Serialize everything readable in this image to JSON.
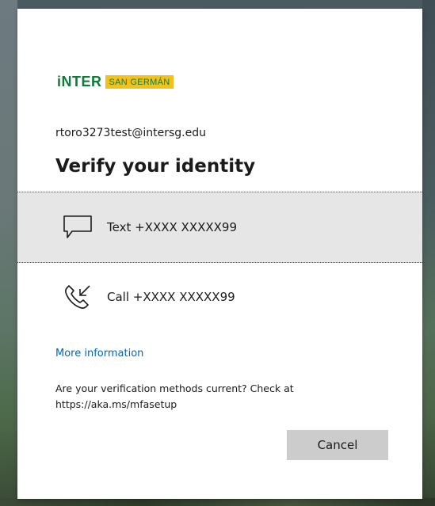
{
  "brand": {
    "name": "iNTER",
    "campus": "SAN GERMÁN"
  },
  "account": {
    "email": "rtoro3273test@intersg.edu"
  },
  "dialog": {
    "title": "Verify your identity",
    "methods": [
      {
        "icon": "sms-icon",
        "label": "Text +XXXX XXXXX99",
        "selected": true
      },
      {
        "icon": "phone-call-icon",
        "label": "Call +XXXX XXXXX99",
        "selected": false
      }
    ],
    "more_info_link": "More information",
    "notice_line1": "Are your verification methods current? Check at",
    "notice_line2": "https://aka.ms/mfasetup",
    "cancel_label": "Cancel"
  },
  "colors": {
    "link": "#0067b8",
    "brand_green": "#0f7b3a",
    "brand_yellow": "#f2c21a",
    "selected_bg": "#e6e6e6",
    "button_bg": "#cccccc"
  }
}
